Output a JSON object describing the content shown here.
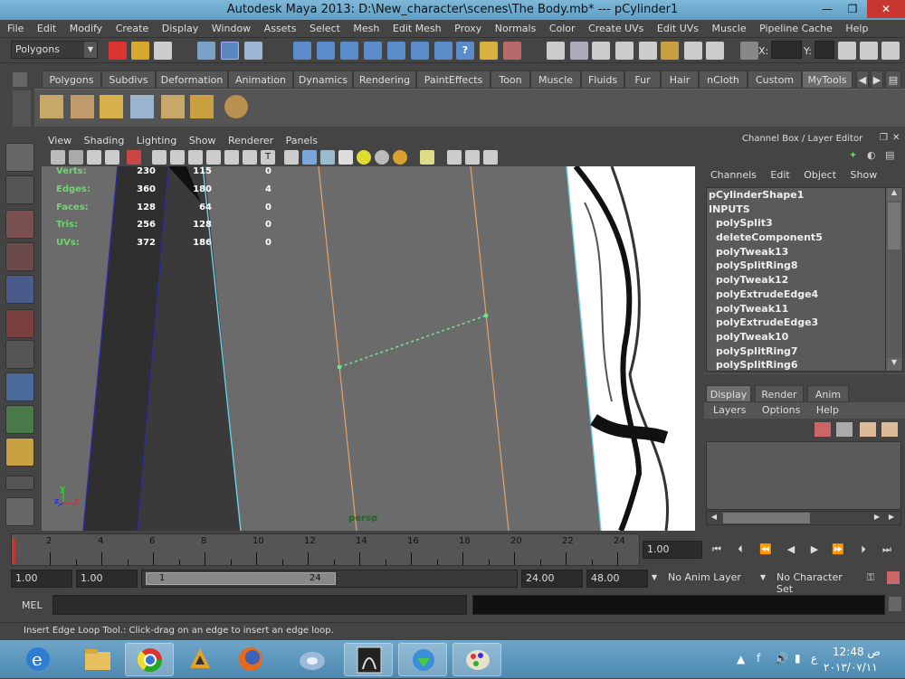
{
  "window": {
    "title": "Autodesk Maya 2013: D:\\New_character\\scenes\\The Body.mb*   ---   pCylinder1"
  },
  "menubar": [
    "File",
    "Edit",
    "Modify",
    "Create",
    "Display",
    "Window",
    "Assets",
    "Select",
    "Mesh",
    "Edit Mesh",
    "Proxy",
    "Normals",
    "Color",
    "Create UVs",
    "Edit UVs",
    "Muscle",
    "Pipeline Cache",
    "Help"
  ],
  "statusline": {
    "mode": "Polygons",
    "x_label": "X:",
    "y_label": "Y:"
  },
  "shelf_tabs": [
    "Polygons",
    "Subdivs",
    "Deformation",
    "Animation",
    "Dynamics",
    "Rendering",
    "PaintEffects",
    "Toon",
    "Muscle",
    "Fluids",
    "Fur",
    "Hair",
    "nCloth",
    "Custom",
    "MyTools"
  ],
  "shelf_active": "MyTools",
  "panel_menu": [
    "View",
    "Shading",
    "Lighting",
    "Show",
    "Renderer",
    "Panels"
  ],
  "hud": {
    "rows": [
      {
        "label": "Verts:",
        "a": "230",
        "b": "115",
        "c": "0"
      },
      {
        "label": "Edges:",
        "a": "360",
        "b": "180",
        "c": "4"
      },
      {
        "label": "Faces:",
        "a": "128",
        "b": "64",
        "c": "0"
      },
      {
        "label": "Tris:",
        "a": "256",
        "b": "128",
        "c": "0"
      },
      {
        "label": "UVs:",
        "a": "372",
        "b": "186",
        "c": "0"
      }
    ],
    "camera": "persp",
    "axis_y": "y",
    "axis_z": "z",
    "axis_x": "x"
  },
  "channel_box": {
    "header": "Channel Box / Layer Editor",
    "menu": [
      "Channels",
      "Edit",
      "Object",
      "Show"
    ],
    "items": [
      "pCylinderShape1",
      "INPUTS",
      "polySplit3",
      "deleteComponent5",
      "polyTweak13",
      "polySplitRing8",
      "polyTweak12",
      "polyExtrudeEdge4",
      "polyTweak11",
      "polyExtrudeEdge3",
      "polyTweak10",
      "polySplitRing7",
      "polySplitRing6"
    ]
  },
  "layer_editor": {
    "tabs": [
      "Display",
      "Render",
      "Anim"
    ],
    "active_tab": "Display",
    "menu": [
      "Layers",
      "Options",
      "Help"
    ]
  },
  "time_slider": {
    "labels": [
      "2",
      "4",
      "6",
      "8",
      "10",
      "12",
      "14",
      "16",
      "18",
      "20",
      "22",
      "24"
    ],
    "current": "1.00"
  },
  "range": {
    "start": "1.00",
    "inner_start": "1.00",
    "range_min": "1",
    "range_max": "24",
    "end": "24.00",
    "outer_end": "48.00",
    "anim_layer": "No Anim Layer",
    "character_set": "No Character Set"
  },
  "command_line": {
    "label": "MEL"
  },
  "help_line": {
    "text": "Insert Edge Loop Tool.: Click-drag on an edge to insert an edge loop."
  },
  "taskbar": {
    "time": "12:48 ص",
    "date": "٢٠١٣/٠٧/١١",
    "lang": "ع"
  }
}
